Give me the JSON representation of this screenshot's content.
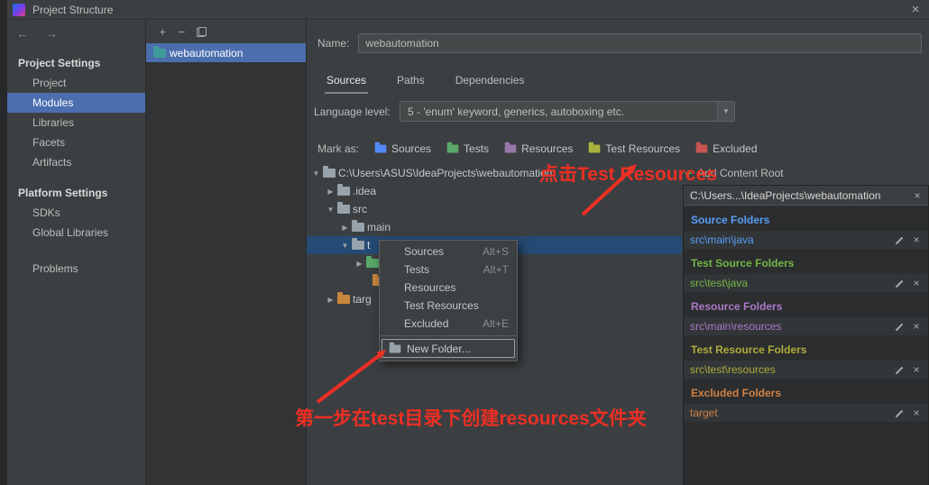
{
  "window": {
    "title": "Project Structure"
  },
  "icons": {
    "close": "×",
    "back": "←",
    "forward": "→",
    "add": "+",
    "remove": "−",
    "dropdown": "▼",
    "expanded": "▼",
    "collapsed": "▶",
    "delete": "×",
    "add_content": "+"
  },
  "colors": {
    "selection_blue": "#4b6eaf",
    "tree_selection": "#254a73",
    "annotation_red": "#ed2f24"
  },
  "sidebar": {
    "sections": [
      {
        "header": "Project Settings",
        "items": [
          {
            "label": "Project",
            "selected": false
          },
          {
            "label": "Modules",
            "selected": true
          },
          {
            "label": "Libraries",
            "selected": false
          },
          {
            "label": "Facets",
            "selected": false
          },
          {
            "label": "Artifacts",
            "selected": false
          }
        ]
      },
      {
        "header": "Platform Settings",
        "items": [
          {
            "label": "SDKs",
            "selected": false
          },
          {
            "label": "Global Libraries",
            "selected": false
          }
        ]
      }
    ],
    "problems_label": "Problems"
  },
  "module_list": {
    "selected_module": "webautomation"
  },
  "editor": {
    "name_label": "Name:",
    "name_value": "webautomation",
    "tabs": [
      {
        "label": "Sources",
        "active": true
      },
      {
        "label": "Paths",
        "active": false
      },
      {
        "label": "Dependencies",
        "active": false
      }
    ],
    "language_level_label": "Language level:",
    "language_level_value": "5 - 'enum' keyword, generics, autoboxing etc.",
    "mark_as_label": "Mark as:",
    "marks": [
      {
        "label": "Sources",
        "color": "#548af7"
      },
      {
        "label": "Tests",
        "color": "#59a869"
      },
      {
        "label": "Resources",
        "color": "#9876aa"
      },
      {
        "label": "Test Resources",
        "color": "#a9b33c"
      },
      {
        "label": "Excluded",
        "color": "#c75450"
      }
    ]
  },
  "tree": {
    "root_label": "C:\\Users\\ASUS\\IdeaProjects\\webautomation",
    "items": [
      {
        "label": ".idea"
      },
      {
        "label": "src"
      },
      {
        "label": "main"
      },
      {
        "label": "t"
      },
      {
        "label": ""
      },
      {
        "label": ""
      },
      {
        "label": "targ"
      }
    ]
  },
  "context_menu": {
    "items": [
      {
        "label": "Sources",
        "shortcut": "Alt+S"
      },
      {
        "label": "Tests",
        "shortcut": "Alt+T"
      },
      {
        "label": "Resources",
        "shortcut": ""
      },
      {
        "label": "Test Resources",
        "shortcut": ""
      },
      {
        "label": "Excluded",
        "shortcut": "Alt+E"
      }
    ],
    "new_folder_label": "New Folder..."
  },
  "content_roots": {
    "add_button_label": "Add Content Root",
    "header": "C:\\Users...\\IdeaProjects\\webautomation",
    "sections": [
      {
        "title": "Source Folders",
        "color": "#589df6",
        "paths": [
          "src\\main\\java"
        ]
      },
      {
        "title": "Test Source Folders",
        "color": "#72b545",
        "paths": [
          "src\\test\\java"
        ]
      },
      {
        "title": "Resource Folders",
        "color": "#ab79c9",
        "paths": [
          "src\\main\\resources"
        ]
      },
      {
        "title": "Test Resource Folders",
        "color": "#b0ab3c",
        "paths": [
          "src\\test\\resources"
        ]
      },
      {
        "title": "Excluded Folders",
        "color": "#d08146",
        "paths": [
          "target"
        ]
      }
    ]
  },
  "annotations": {
    "click_test_resources": "点击Test Resources",
    "step_one": "第一步在test目录下创建resources文件夹"
  }
}
